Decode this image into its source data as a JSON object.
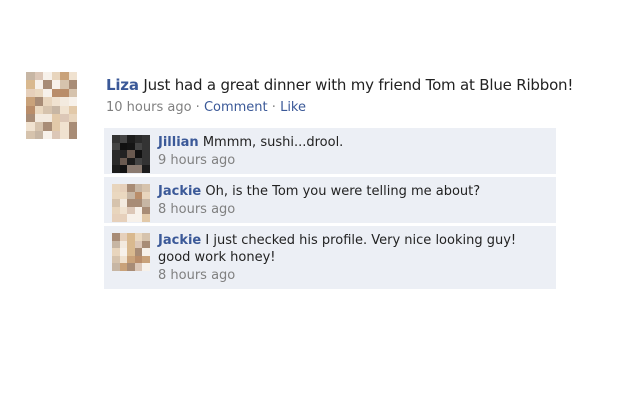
{
  "post": {
    "author": "Liza",
    "text": "Just had a great dinner with my friend Tom at Blue Ribbon!",
    "time": "10 hours ago",
    "separator": "·",
    "comment_label": "Comment",
    "like_label": "Like"
  },
  "comments": [
    {
      "author": "Jillian",
      "text": "Mmmm, sushi...drool.",
      "time": "9 hours ago"
    },
    {
      "author": "Jackie",
      "text": "Oh, is the Tom you were telling me about?",
      "time": "8 hours ago"
    },
    {
      "author": "Jackie",
      "text": "I just checked his profile. Very nice looking guy! good work honey!",
      "time": "8 hours ago"
    }
  ],
  "colors": {
    "link": "#3b5998",
    "comment_bg": "#eceff5",
    "meta_gray": "#808080"
  }
}
